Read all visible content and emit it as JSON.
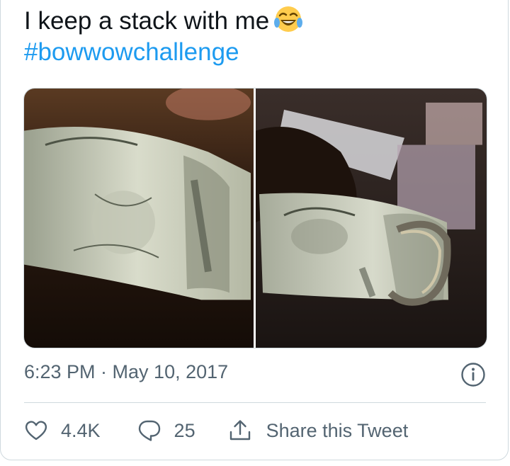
{
  "tweet": {
    "text_line1": "I keep a stack with me",
    "emoji": "face-with-tears-of-joy",
    "hashtag": "#bowwowchallenge"
  },
  "media": {
    "photos": [
      {
        "subject": "rolled stack of dollar bills, close-up"
      },
      {
        "subject": "hand holding folded stack of dollar bills"
      }
    ]
  },
  "meta": {
    "timestamp": "6:23 PM · May 10, 2017"
  },
  "actions": {
    "likes": "4.4K",
    "replies": "25",
    "share_label": "Share this Tweet"
  },
  "colors": {
    "text": "#0f1419",
    "link": "#1d9bf0",
    "secondary": "#536471",
    "border": "#cfd9de"
  },
  "icons": [
    "heart-icon",
    "reply-icon",
    "share-icon",
    "info-icon"
  ]
}
